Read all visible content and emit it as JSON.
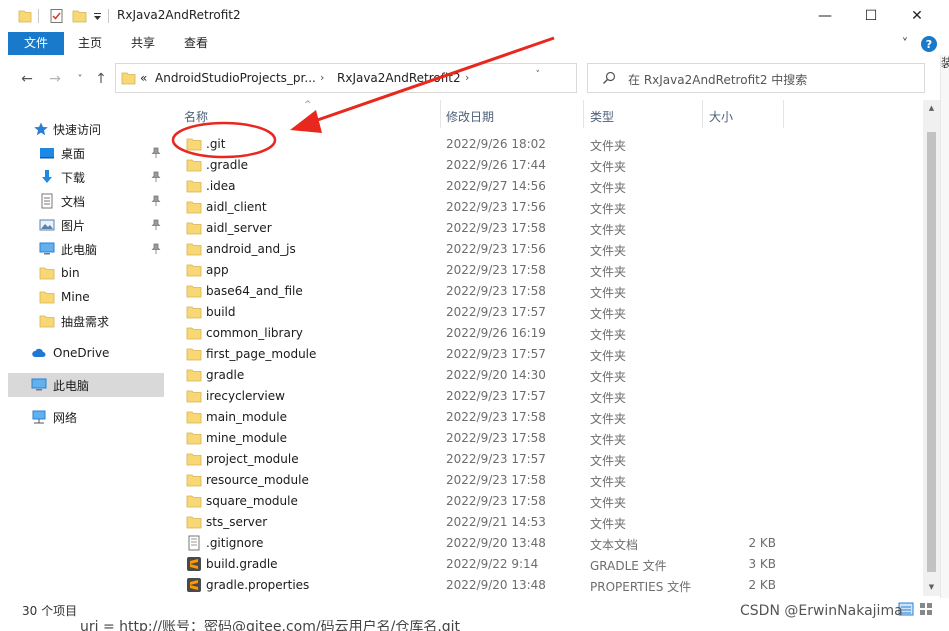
{
  "window": {
    "title": "RxJava2AndRetrofit2",
    "minimize_glyph": "—",
    "maximize_glyph": "☐",
    "close_glyph": "✕"
  },
  "ribbon": {
    "tabs": [
      "文件",
      "主页",
      "共享",
      "查看"
    ],
    "expand_glyph": "˅",
    "help_glyph": "?"
  },
  "address": {
    "back_glyph": "←",
    "forward_glyph": "→",
    "recent_glyph": "˅",
    "up_glyph": "↑",
    "overflow": "«",
    "crumbs": [
      "AndroidStudioProjects_pr...",
      "RxJava2AndRetrofit2"
    ],
    "chevron": "›",
    "dropdown_glyph": "˅",
    "refresh_glyph": "↻"
  },
  "search": {
    "placeholder": "在 RxJava2AndRetrofit2 中搜索"
  },
  "nav": {
    "quick_access": "快速访问",
    "items": [
      {
        "label": "桌面",
        "icon": "desktop-icon",
        "pinned": true
      },
      {
        "label": "下载",
        "icon": "download-icon",
        "pinned": true
      },
      {
        "label": "文档",
        "icon": "documents-icon",
        "pinned": true
      },
      {
        "label": "图片",
        "icon": "pictures-icon",
        "pinned": true
      },
      {
        "label": "此电脑",
        "icon": "computer-icon",
        "pinned": true
      },
      {
        "label": "bin",
        "icon": "folder-icon",
        "pinned": false
      },
      {
        "label": "Mine",
        "icon": "folder-icon",
        "pinned": false
      },
      {
        "label": "抽盘需求",
        "icon": "folder-icon",
        "pinned": false
      }
    ],
    "onedrive": "OneDrive",
    "this_pc": "此电脑",
    "network": "网络"
  },
  "columns": {
    "name": "名称",
    "modified": "修改日期",
    "type": "类型",
    "size": "大小"
  },
  "files": [
    {
      "name": ".git",
      "date": "2022/9/26 18:02",
      "type": "文件夹",
      "size": "",
      "icon": "folder"
    },
    {
      "name": ".gradle",
      "date": "2022/9/26 17:44",
      "type": "文件夹",
      "size": "",
      "icon": "folder"
    },
    {
      "name": ".idea",
      "date": "2022/9/27 14:56",
      "type": "文件夹",
      "size": "",
      "icon": "folder"
    },
    {
      "name": "aidl_client",
      "date": "2022/9/23 17:56",
      "type": "文件夹",
      "size": "",
      "icon": "folder"
    },
    {
      "name": "aidl_server",
      "date": "2022/9/23 17:58",
      "type": "文件夹",
      "size": "",
      "icon": "folder"
    },
    {
      "name": "android_and_js",
      "date": "2022/9/23 17:56",
      "type": "文件夹",
      "size": "",
      "icon": "folder"
    },
    {
      "name": "app",
      "date": "2022/9/23 17:58",
      "type": "文件夹",
      "size": "",
      "icon": "folder"
    },
    {
      "name": "base64_and_file",
      "date": "2022/9/23 17:58",
      "type": "文件夹",
      "size": "",
      "icon": "folder"
    },
    {
      "name": "build",
      "date": "2022/9/23 17:57",
      "type": "文件夹",
      "size": "",
      "icon": "folder"
    },
    {
      "name": "common_library",
      "date": "2022/9/26 16:19",
      "type": "文件夹",
      "size": "",
      "icon": "folder"
    },
    {
      "name": "first_page_module",
      "date": "2022/9/23 17:57",
      "type": "文件夹",
      "size": "",
      "icon": "folder"
    },
    {
      "name": "gradle",
      "date": "2022/9/20 14:30",
      "type": "文件夹",
      "size": "",
      "icon": "folder"
    },
    {
      "name": "irecyclerview",
      "date": "2022/9/23 17:57",
      "type": "文件夹",
      "size": "",
      "icon": "folder"
    },
    {
      "name": "main_module",
      "date": "2022/9/23 17:58",
      "type": "文件夹",
      "size": "",
      "icon": "folder"
    },
    {
      "name": "mine_module",
      "date": "2022/9/23 17:58",
      "type": "文件夹",
      "size": "",
      "icon": "folder"
    },
    {
      "name": "project_module",
      "date": "2022/9/23 17:57",
      "type": "文件夹",
      "size": "",
      "icon": "folder"
    },
    {
      "name": "resource_module",
      "date": "2022/9/23 17:58",
      "type": "文件夹",
      "size": "",
      "icon": "folder"
    },
    {
      "name": "square_module",
      "date": "2022/9/23 17:58",
      "type": "文件夹",
      "size": "",
      "icon": "folder"
    },
    {
      "name": "sts_server",
      "date": "2022/9/21 14:53",
      "type": "文件夹",
      "size": "",
      "icon": "folder"
    },
    {
      "name": ".gitignore",
      "date": "2022/9/20 13:48",
      "type": "文本文档",
      "size": "2 KB",
      "icon": "text"
    },
    {
      "name": "build.gradle",
      "date": "2022/9/22 9:14",
      "type": "GRADLE 文件",
      "size": "3 KB",
      "icon": "sublime"
    },
    {
      "name": "gradle.properties",
      "date": "2022/9/20 13:48",
      "type": "PROPERTIES 文件",
      "size": "2 KB",
      "icon": "sublime"
    }
  ],
  "status": {
    "count": "30 个项目"
  },
  "right_edge_text": "装",
  "bottom_text": "uri = http://账号：密码@gitee.com/码云用户名/仓库名.git",
  "watermark": "CSDN @ErwinNakajima",
  "colors": {
    "file_tab": "#1979ca",
    "folder": "#f8d775",
    "annotation": "#e8281e",
    "header_text": "#4c607a"
  }
}
